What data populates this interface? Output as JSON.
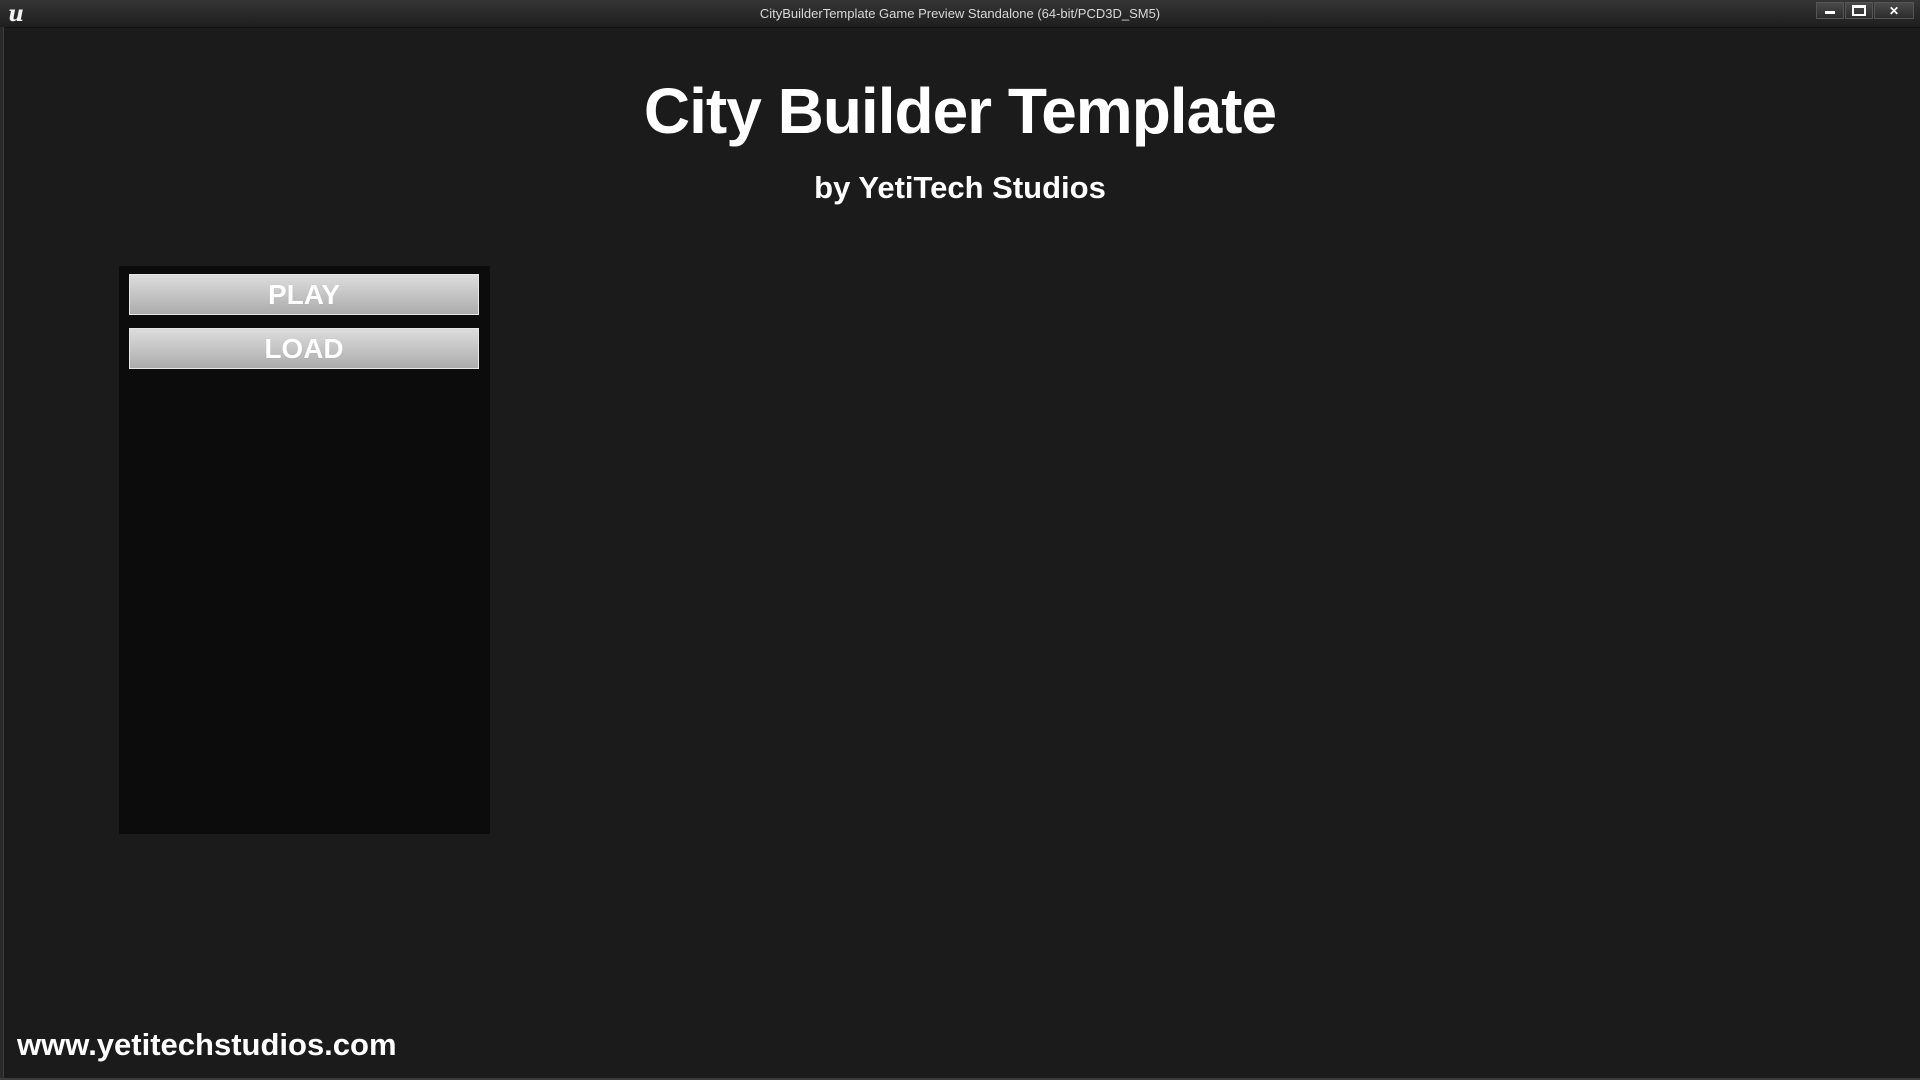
{
  "window": {
    "title": "CityBuilderTemplate Game Preview Standalone (64-bit/PCD3D_SM5)",
    "logo_glyph": "u",
    "close_glyph": "✕"
  },
  "main_menu": {
    "title": "City Builder Template",
    "subtitle": "by YetiTech Studios",
    "buttons": [
      {
        "label": "PLAY"
      },
      {
        "label": "LOAD"
      }
    ]
  },
  "footer": {
    "website": "www.yetitechstudios.com"
  }
}
